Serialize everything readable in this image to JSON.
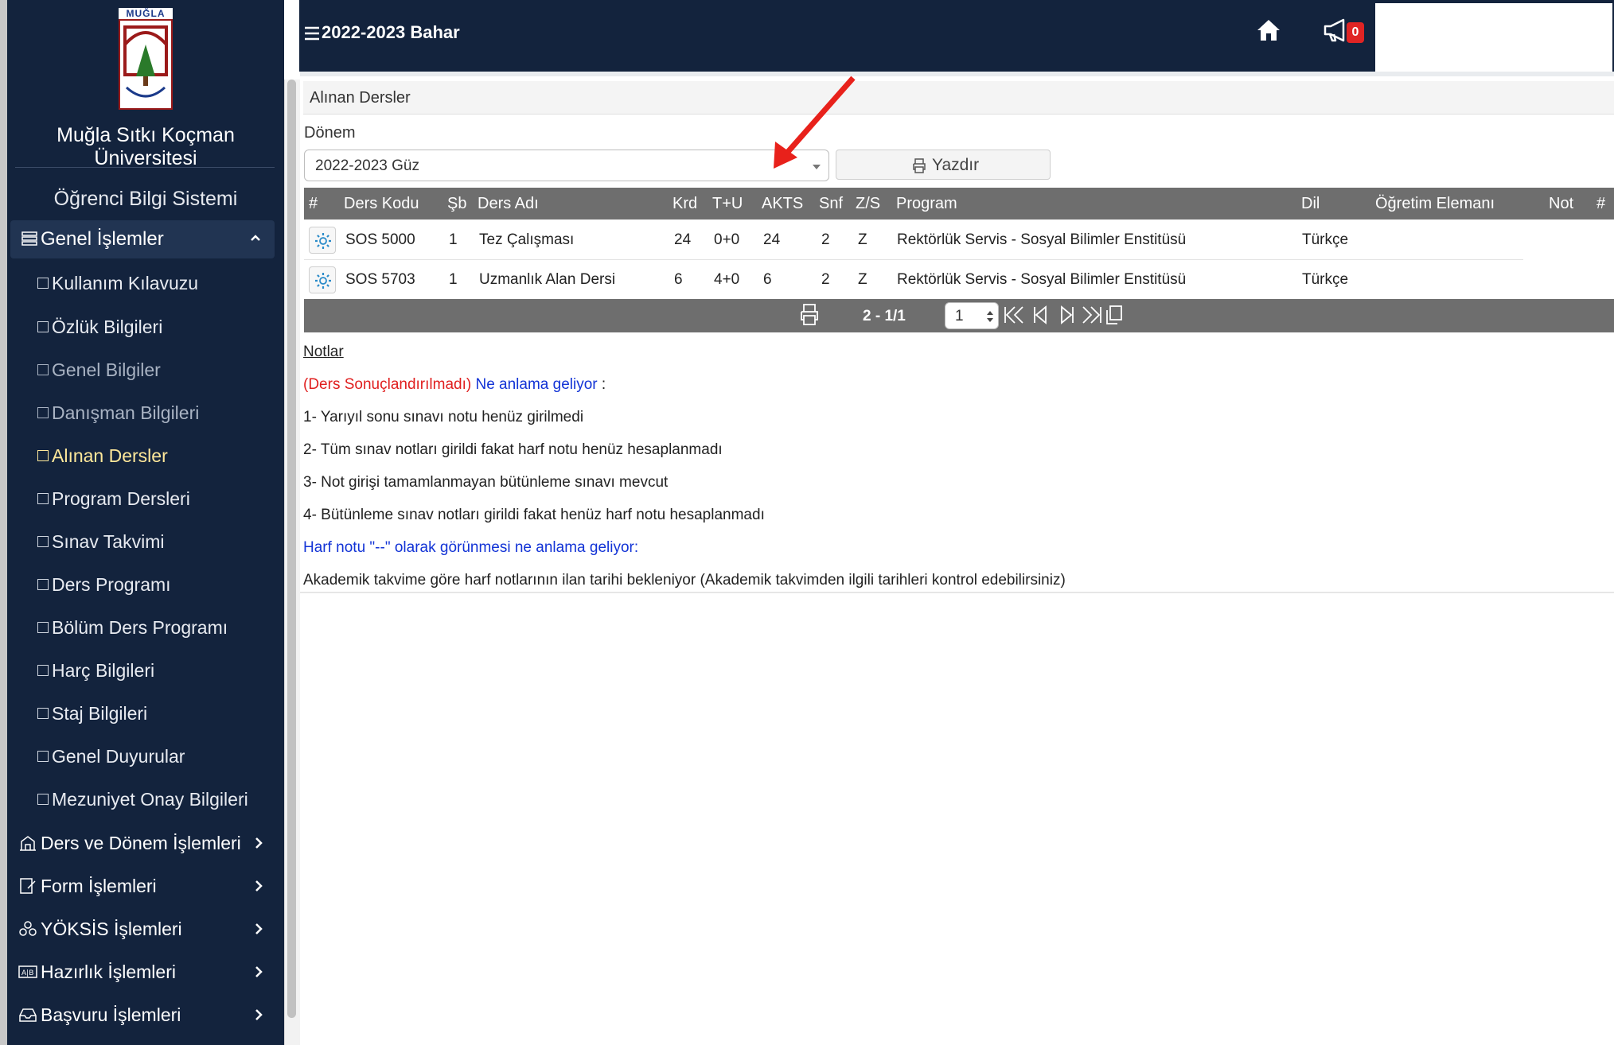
{
  "sidebar": {
    "logo_text": "MUĞLA",
    "university": "Muğla Sıtkı Koçman Üniversitesi",
    "system": "Öğrenci Bilgi Sistemi",
    "group": "Genel İşlemler",
    "sub_items": [
      {
        "label": "Kullanım Kılavuzu",
        "state": "normal"
      },
      {
        "label": "Özlük Bilgileri",
        "state": "normal"
      },
      {
        "label": "Genel Bilgiler",
        "state": "muted"
      },
      {
        "label": "Danışman Bilgileri",
        "state": "muted"
      },
      {
        "label": "Alınan Dersler",
        "state": "active"
      },
      {
        "label": "Program Dersleri",
        "state": "normal"
      },
      {
        "label": "Sınav Takvimi",
        "state": "normal"
      },
      {
        "label": "Ders Programı",
        "state": "normal"
      },
      {
        "label": "Bölüm Ders Programı",
        "state": "normal"
      },
      {
        "label": "Harç Bilgileri",
        "state": "normal"
      },
      {
        "label": "Staj Bilgileri",
        "state": "normal"
      },
      {
        "label": "Genel Duyurular",
        "state": "normal"
      },
      {
        "label": "Mezuniyet Onay Bilgileri",
        "state": "normal"
      }
    ],
    "main_items": [
      {
        "label": "Ders ve Dönem İşlemleri",
        "icon": "building-icon"
      },
      {
        "label": "Form İşlemleri",
        "icon": "form-icon"
      },
      {
        "label": "YÖKSİS İşlemleri",
        "icon": "cluster-icon"
      },
      {
        "label": "Hazırlık İşlemleri",
        "icon": "ab-icon"
      },
      {
        "label": "Başvuru İşlemleri",
        "icon": "inbox-icon"
      }
    ]
  },
  "topbar": {
    "title": "2022-2023 Bahar",
    "notification_count": "0"
  },
  "page": {
    "header": "Alınan Dersler",
    "donem_label": "Dönem",
    "donem_value": "2022-2023 Güz",
    "print_label": "Yazdır"
  },
  "table": {
    "columns": [
      "#",
      "Ders Kodu",
      "Şb",
      "Ders Adı",
      "Krd",
      "T+U",
      "AKTS",
      "Snf",
      "Z/S",
      "Program",
      "Dil",
      "Öğretim Elemanı",
      "Not",
      "#"
    ],
    "rows": [
      {
        "code": "SOS 5000",
        "sb": "1",
        "name": "Tez Çalışması",
        "krd": "24",
        "tu": "0+0",
        "akts": "24",
        "snf": "2",
        "zs": "Z",
        "program": "Rektörlük Servis - Sosyal Bilimler Enstitüsü",
        "dil": "Türkçe"
      },
      {
        "code": "SOS 5703",
        "sb": "1",
        "name": "Uzmanlık Alan Dersi",
        "krd": "6",
        "tu": "4+0",
        "akts": "6",
        "snf": "2",
        "zs": "Z",
        "program": "Rektörlük Servis - Sosyal Bilimler Enstitüsü",
        "dil": "Türkçe"
      }
    ]
  },
  "pager": {
    "count": "2 - 1/1",
    "page": "1"
  },
  "notes": {
    "title": "Notlar",
    "red_text": "(Ders Sonuçlandırılmadı)",
    "blue_text": "Ne anlama geliyor",
    "colon": " :",
    "items": [
      "1- Yarıyıl sonu sınavı notu henüz girilmedi",
      "2- Tüm sınav notları girildi fakat harf notu henüz hesaplanmadı",
      "3- Not girişi tamamlanmayan bütünleme sınavı mevcut",
      "4- Bütünleme sınav notları girildi fakat henüz harf notu hesaplanmadı"
    ],
    "harf_question": "Harf notu \"--\" olarak görünmesi ne anlama geliyor:",
    "harf_answer": "Akademik takvime göre harf notlarının ilan tarihi bekleniyor (Akademik takvimden ilgili tarihleri kontrol edebilirsiniz)"
  },
  "colors": {
    "sidebar_bg": "#13233d",
    "active_item": "#ffe89a",
    "table_header": "#6e6e6e",
    "badge": "#e02424",
    "arrow": "#e8211b"
  }
}
